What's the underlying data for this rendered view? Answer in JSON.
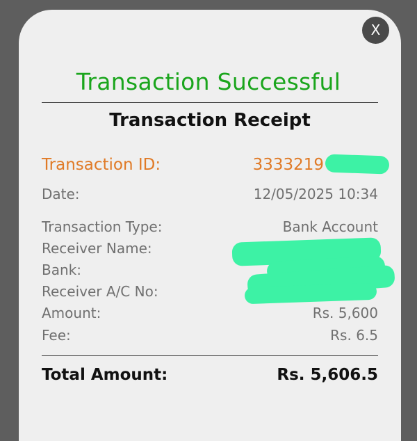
{
  "dialog": {
    "close_label": "X",
    "success_title": "Transaction Successful",
    "receipt_title": "Transaction Receipt"
  },
  "receipt": {
    "transaction_id_label": "Transaction ID:",
    "transaction_id_value": "3333219",
    "date_label": "Date:",
    "date_value": "12/05/2025 10:34",
    "type_label": "Transaction Type:",
    "type_value": "Bank Account",
    "receiver_name_label": "Receiver Name:",
    "bank_label": "Bank:",
    "account_label": "Receiver A/C No:",
    "amount_label": "Amount:",
    "amount_value": "Rs. 5,600",
    "fee_label": "Fee:",
    "fee_value": "Rs. 6.5",
    "total_label": "Total Amount:",
    "total_value": "Rs. 5,606.5"
  },
  "colors": {
    "success": "#1aa51c",
    "accent": "#e07a26",
    "redaction": "#3df2a5"
  }
}
